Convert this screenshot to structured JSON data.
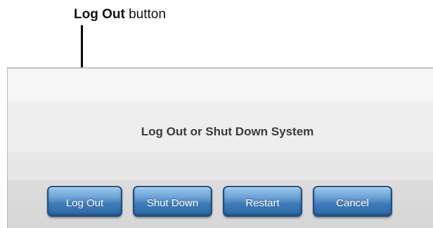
{
  "callout": {
    "label_bold": "Log Out",
    "label_rest": " button"
  },
  "dialog": {
    "title": "Log Out or Shut Down System"
  },
  "buttons": {
    "log_out": "Log Out",
    "shut_down": "Shut Down",
    "restart": "Restart",
    "cancel": "Cancel"
  },
  "colors": {
    "button_fill": "#3f7ab8",
    "button_border": "#1f4f86",
    "button_text": "#ffffff",
    "title_text": "#3a3a3a"
  }
}
